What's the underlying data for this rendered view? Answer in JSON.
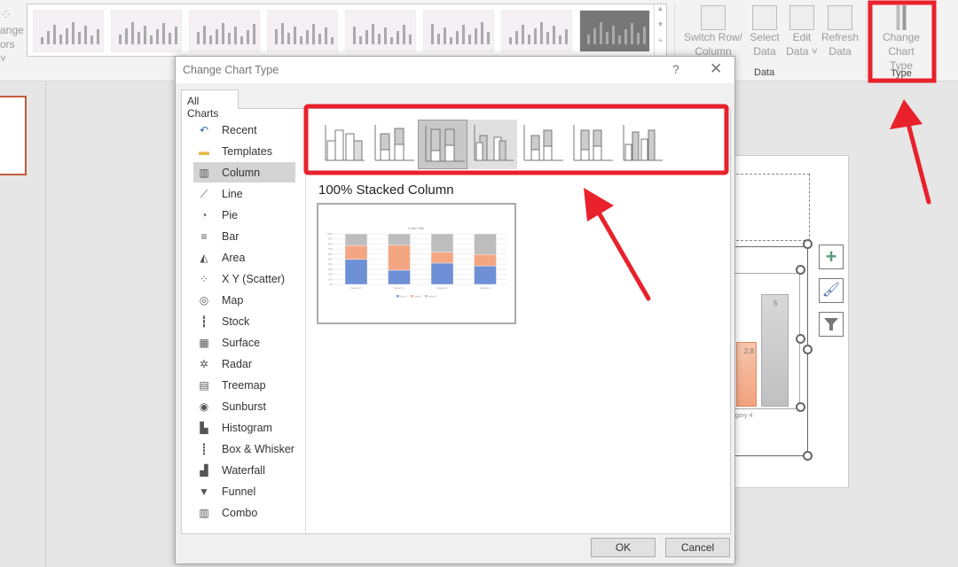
{
  "ribbon": {
    "left_button_partial": [
      "ange",
      "ors ˅"
    ],
    "data_group": {
      "label": "Data",
      "buttons": [
        {
          "label": "Switch Row/ Column",
          "icon": "switch-row-column-icon"
        },
        {
          "label": "Select Data",
          "icon": "select-data-icon"
        },
        {
          "label": "Edit Data ˅",
          "icon": "edit-data-icon"
        },
        {
          "label": "Refresh Data",
          "icon": "refresh-data-icon"
        }
      ]
    },
    "type_group": {
      "label": "Type",
      "button": "Change Chart Type",
      "icon": "change-chart-type-icon"
    }
  },
  "dialog": {
    "title": "Change Chart Type",
    "help": "?",
    "close": "✕",
    "tab": "All Charts",
    "chart_types": [
      {
        "label": "Recent",
        "icon": "recent-icon"
      },
      {
        "label": "Templates",
        "icon": "folder-icon"
      },
      {
        "label": "Column",
        "icon": "column-chart-icon",
        "selected": true
      },
      {
        "label": "Line",
        "icon": "line-chart-icon"
      },
      {
        "label": "Pie",
        "icon": "pie-chart-icon"
      },
      {
        "label": "Bar",
        "icon": "bar-chart-icon"
      },
      {
        "label": "Area",
        "icon": "area-chart-icon"
      },
      {
        "label": "X Y (Scatter)",
        "icon": "scatter-chart-icon"
      },
      {
        "label": "Map",
        "icon": "map-chart-icon"
      },
      {
        "label": "Stock",
        "icon": "stock-chart-icon"
      },
      {
        "label": "Surface",
        "icon": "surface-chart-icon"
      },
      {
        "label": "Radar",
        "icon": "radar-chart-icon"
      },
      {
        "label": "Treemap",
        "icon": "treemap-icon"
      },
      {
        "label": "Sunburst",
        "icon": "sunburst-icon"
      },
      {
        "label": "Histogram",
        "icon": "histogram-icon"
      },
      {
        "label": "Box & Whisker",
        "icon": "box-whisker-icon"
      },
      {
        "label": "Waterfall",
        "icon": "waterfall-icon"
      },
      {
        "label": "Funnel",
        "icon": "funnel-icon"
      },
      {
        "label": "Combo",
        "icon": "combo-chart-icon"
      }
    ],
    "subtypes": [
      "Clustered Column",
      "Stacked Column",
      "100% Stacked Column",
      "3-D Clustered Column",
      "3-D Stacked Column",
      "3-D 100% Stacked Column",
      "3-D Column"
    ],
    "selected_subtype": "100% Stacked Column",
    "preview": {
      "title": "Chart Title",
      "categories": [
        "Category 1",
        "Category 2",
        "Category 3",
        "Category 4"
      ],
      "series": [
        {
          "name": "Series 1",
          "color": "#6f8fd6",
          "values": [
            4.3,
            2.5,
            3.5,
            4.5
          ]
        },
        {
          "name": "Series 2",
          "color": "#f4a582",
          "values": [
            2.4,
            4.4,
            1.8,
            2.8
          ]
        },
        {
          "name": "Series 3",
          "color": "#bdbdbd",
          "values": [
            2,
            2,
            3,
            5
          ]
        }
      ]
    },
    "ok": "OK",
    "cancel": "Cancel"
  },
  "slide_chart": {
    "bar_labels": [
      "2.8",
      "5"
    ],
    "category_label": "egory 4"
  },
  "colors": {
    "annotation_red": "#e8212b",
    "selection": "#c55a3a"
  }
}
